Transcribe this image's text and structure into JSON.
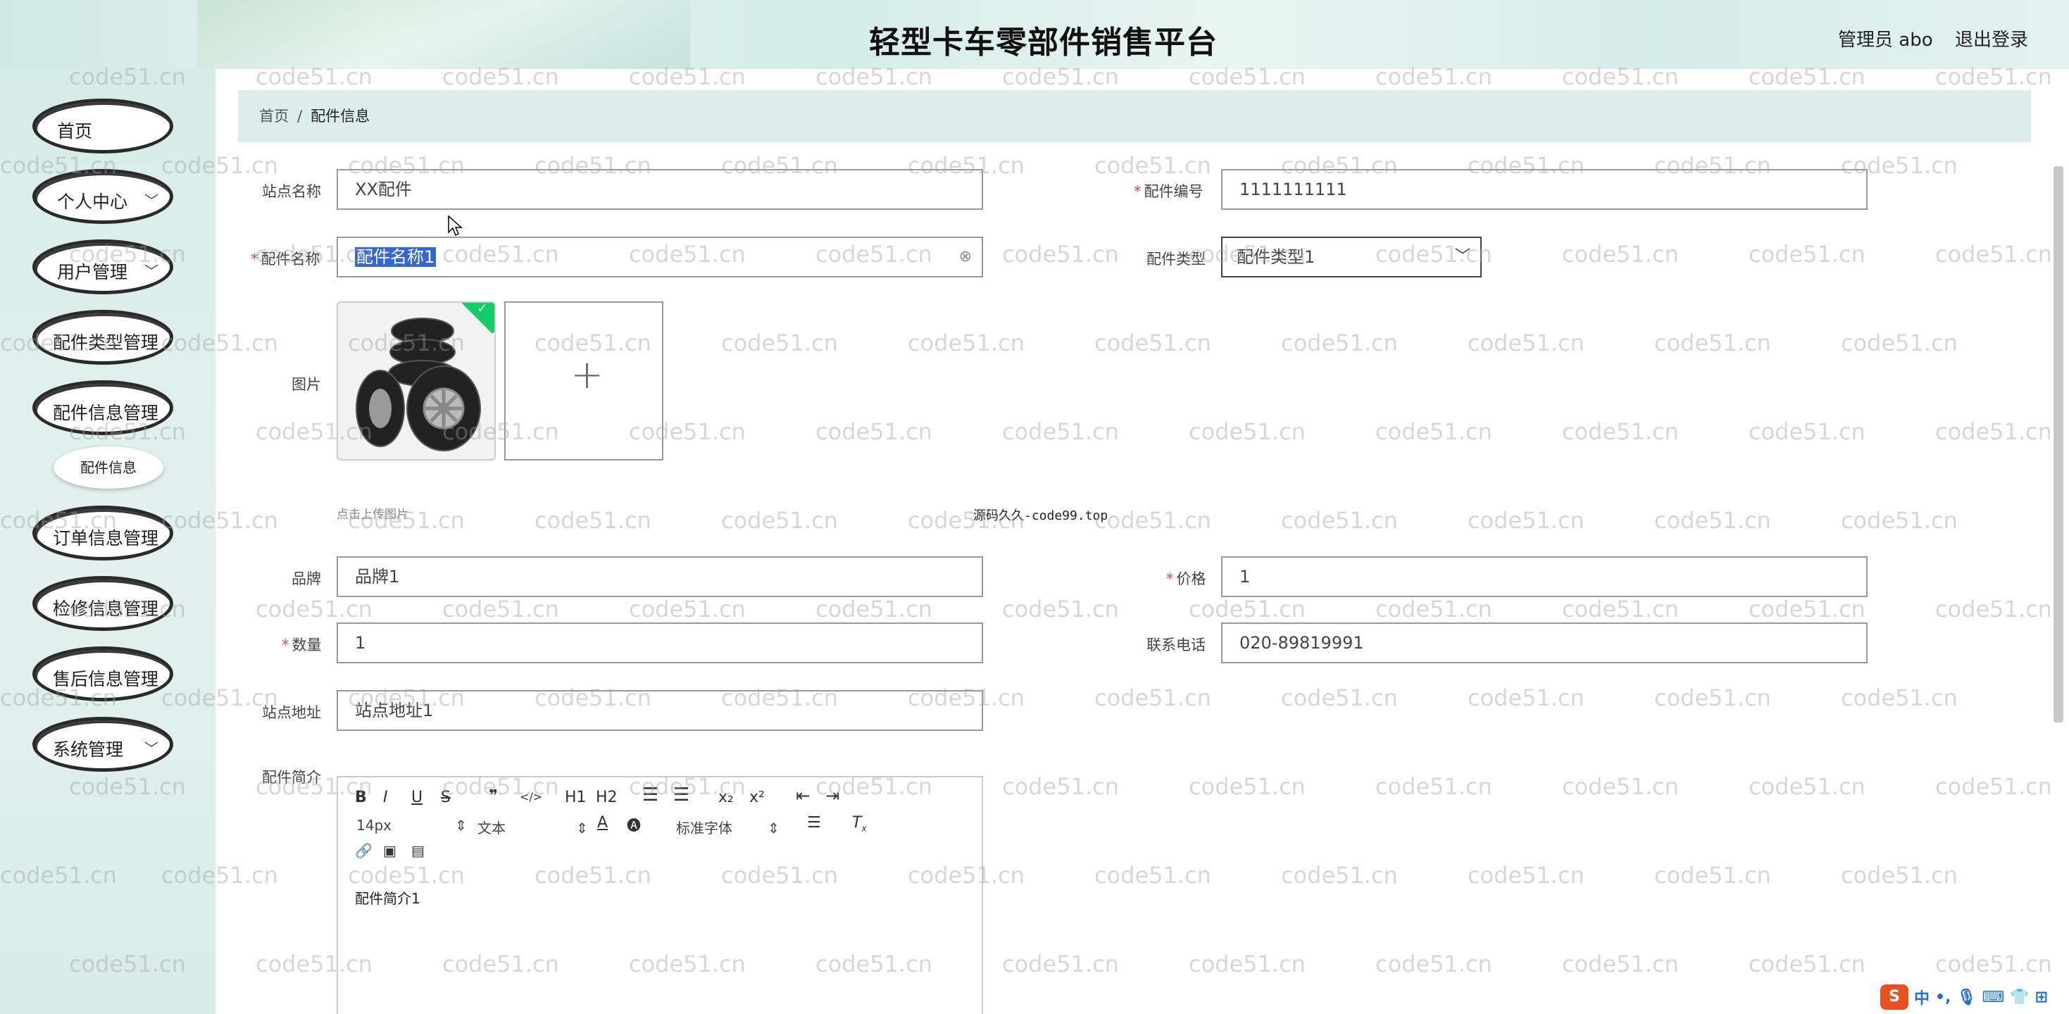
{
  "header": {
    "title": "轻型卡车零部件销售平台",
    "user": "管理员 abo",
    "logout": "退出登录"
  },
  "sidebar": {
    "items": [
      {
        "label": "首页",
        "has_chevron": false
      },
      {
        "label": "个人中心",
        "has_chevron": true
      },
      {
        "label": "用户管理",
        "has_chevron": true
      },
      {
        "label": "配件类型管理",
        "has_chevron": false
      },
      {
        "label": "配件信息管理",
        "has_chevron": false
      },
      {
        "label": "订单信息管理",
        "has_chevron": false
      },
      {
        "label": "检修信息管理",
        "has_chevron": false
      },
      {
        "label": "售后信息管理",
        "has_chevron": false
      },
      {
        "label": "系统管理",
        "has_chevron": true
      }
    ],
    "subitem": "配件信息"
  },
  "breadcrumb": {
    "home": "首页",
    "sep": "/",
    "current": "配件信息"
  },
  "form": {
    "site_name": {
      "label": "站点名称",
      "value": "XX配件"
    },
    "part_no": {
      "label": "配件编号",
      "value": "1111111111",
      "required": true
    },
    "part_name": {
      "label": "配件名称",
      "value": "配件名称1",
      "required": true
    },
    "part_type": {
      "label": "配件类型",
      "value": "配件类型1"
    },
    "image": {
      "label": "图片",
      "hint": "点击上传图片"
    },
    "brand": {
      "label": "品牌",
      "value": "品牌1"
    },
    "price": {
      "label": "价格",
      "value": "1",
      "required": true
    },
    "quantity": {
      "label": "数量",
      "value": "1",
      "required": true
    },
    "phone": {
      "label": "联系电话",
      "value": "020-89819991"
    },
    "site_address": {
      "label": "站点地址",
      "value": "站点地址1"
    },
    "intro": {
      "label": "配件简介",
      "content": "配件简介1"
    }
  },
  "overlay_text": "源码久久-code99.top",
  "editor": {
    "font_size": "14px",
    "header_select": "文本",
    "font_family": "标准字体",
    "buttons": [
      "B",
      "I",
      "U",
      "S",
      "❞",
      "</>",
      "H1",
      "H2",
      "ol",
      "ul",
      "x₂",
      "x²",
      "indent-",
      "indent+"
    ]
  },
  "watermark": "code51.cn",
  "ime": {
    "logo": "S",
    "mode": "中"
  },
  "colors": {
    "required": "#e04848",
    "selection": "#3367d6",
    "upload_ok": "#13ce66",
    "breadcrumb_bg": "#dcedeb"
  }
}
